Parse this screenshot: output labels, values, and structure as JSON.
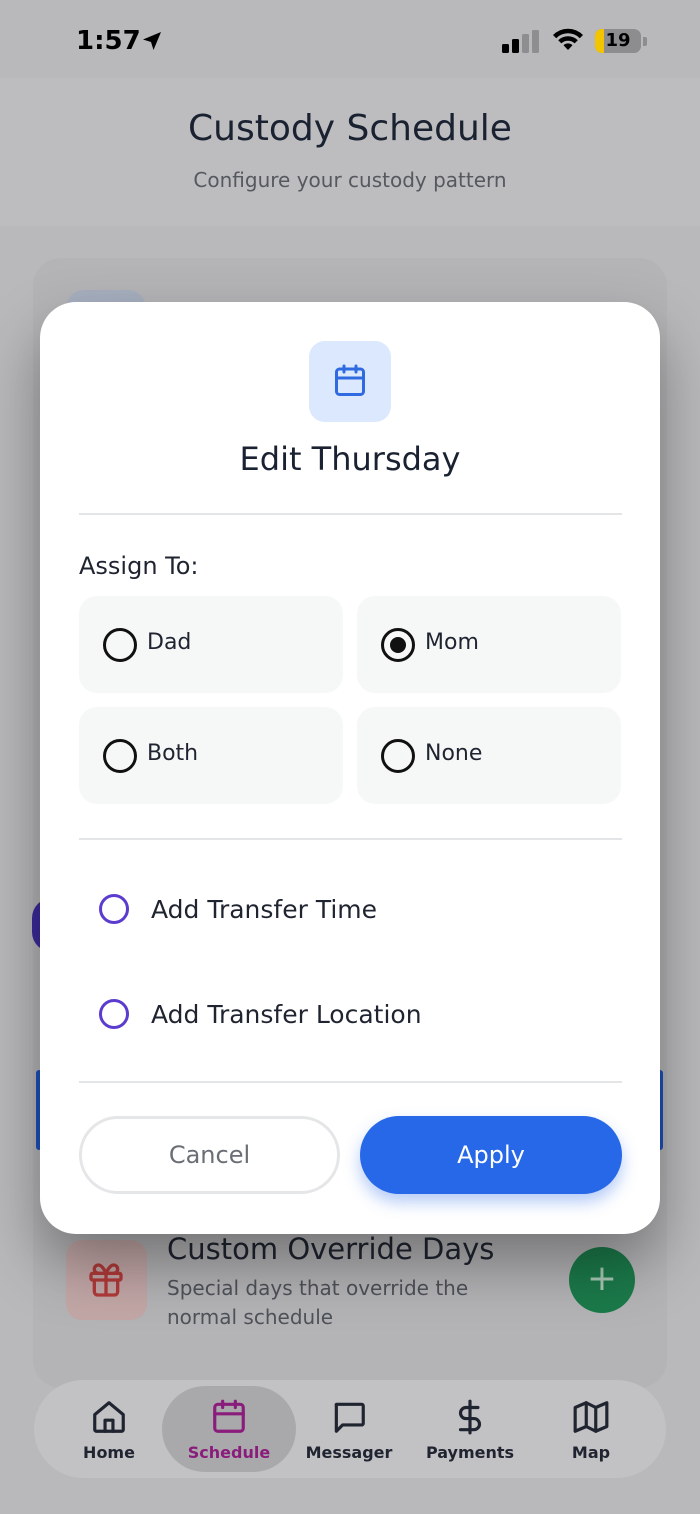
{
  "status_bar": {
    "time": "1:57",
    "battery": "19",
    "battery_level": 0.19,
    "icons": [
      "location-arrow-icon",
      "signal-icon",
      "wifi-icon",
      "battery-icon"
    ]
  },
  "header": {
    "title": "Custody Schedule",
    "subtitle": "Configure your custody pattern"
  },
  "background": {
    "override_title": "Custom Override Days",
    "override_desc": "Special days that override the normal schedule",
    "override_icon": "gift-icon",
    "fab_label": "+"
  },
  "modal": {
    "icon": "calendar-icon",
    "title": "Edit Thursday",
    "assign_label": "Assign To:",
    "options": [
      {
        "label": "Dad",
        "selected": false
      },
      {
        "label": "Mom",
        "selected": true
      },
      {
        "label": "Both",
        "selected": false
      },
      {
        "label": "None",
        "selected": false
      }
    ],
    "toggles": [
      {
        "label": "Add Transfer Time"
      },
      {
        "label": "Add Transfer Location"
      }
    ],
    "cancel_label": "Cancel",
    "apply_label": "Apply"
  },
  "colors": {
    "accent": "#2668e8",
    "toggle_accent": "#5b3ccf",
    "active_tab": "#8a1c7c"
  },
  "tab_bar": {
    "active": "Schedule",
    "tabs": [
      {
        "label": "Home",
        "icon": "home-icon"
      },
      {
        "label": "Schedule",
        "icon": "calendar-icon"
      },
      {
        "label": "Messager",
        "icon": "message-icon"
      },
      {
        "label": "Payments",
        "icon": "dollar-icon"
      },
      {
        "label": "Map",
        "icon": "map-icon"
      }
    ]
  }
}
